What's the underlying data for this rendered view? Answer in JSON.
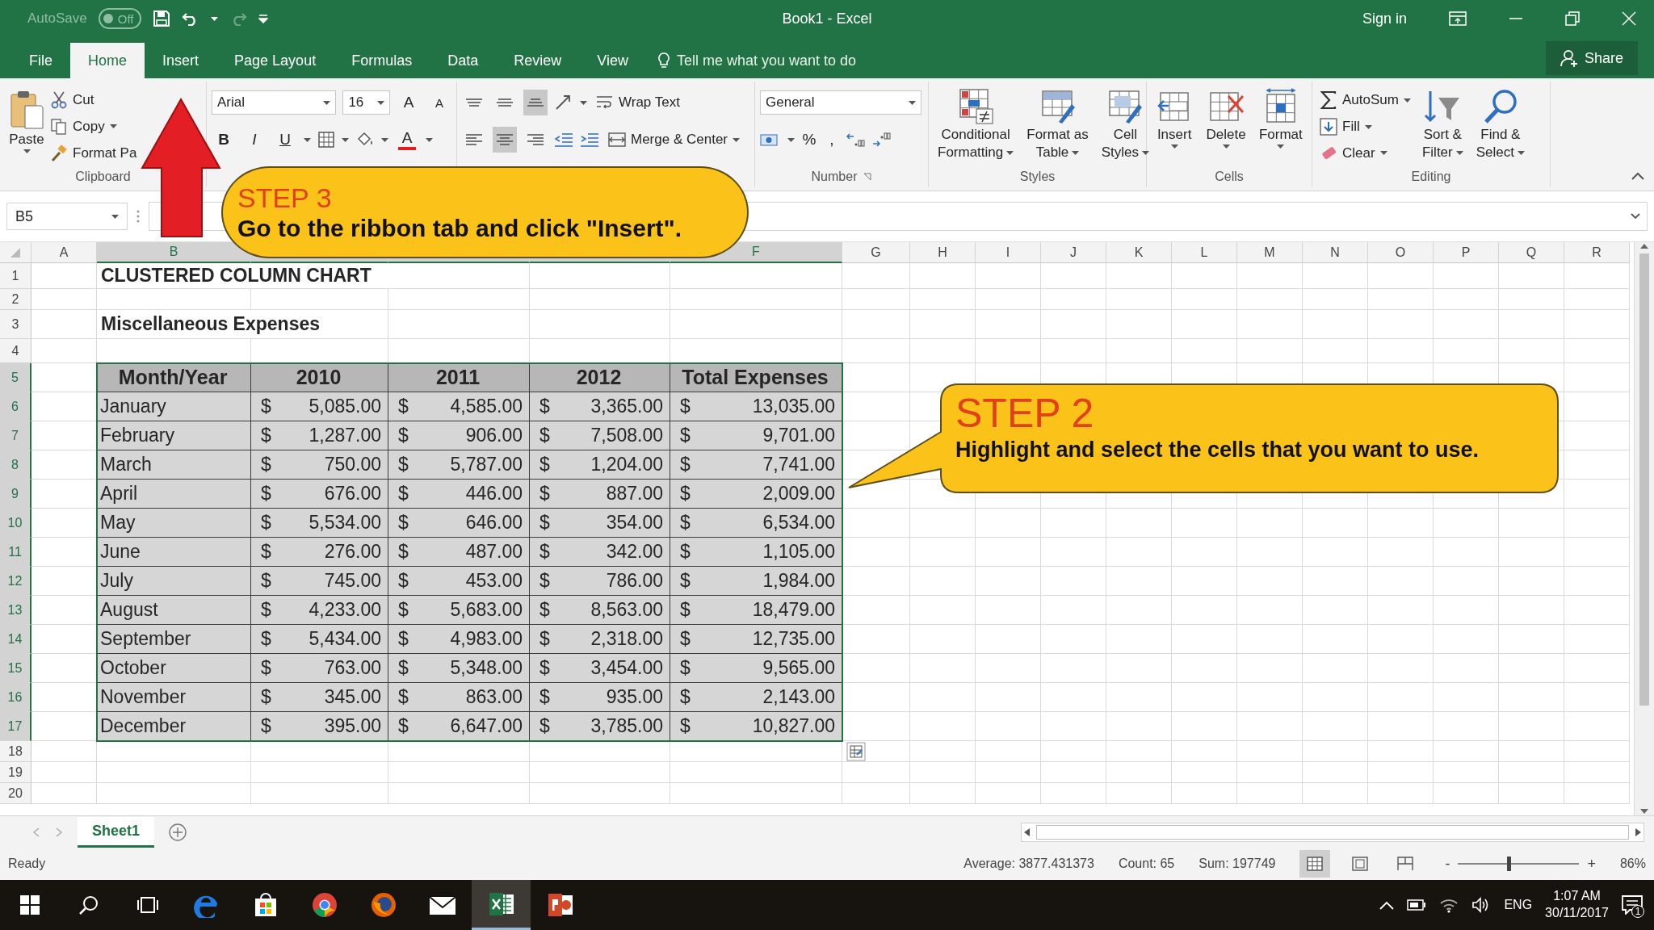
{
  "window": {
    "autosave": {
      "label": "AutoSave",
      "on": false,
      "state_text": "Off"
    },
    "title": "Book1 - Excel",
    "sign_in": "Sign in"
  },
  "tabs": [
    {
      "label": "File",
      "selected": false
    },
    {
      "label": "Home",
      "selected": true
    },
    {
      "label": "Insert",
      "selected": false
    },
    {
      "label": "Page Layout",
      "selected": false
    },
    {
      "label": "Formulas",
      "selected": false
    },
    {
      "label": "Data",
      "selected": false
    },
    {
      "label": "Review",
      "selected": false
    },
    {
      "label": "View",
      "selected": false
    }
  ],
  "tell_me": "Tell me what you want to do",
  "share": "Share",
  "ribbon": {
    "clipboard": {
      "paste": "Paste",
      "commands": [
        {
          "kind": "cut",
          "label": "Cut"
        },
        {
          "kind": "copy",
          "label": "Copy"
        },
        {
          "kind": "painter",
          "label": "Format Pa"
        }
      ],
      "label": "Clipboard"
    },
    "font": {
      "name": "Arial",
      "size": "16",
      "grow": "A",
      "shrink": "A",
      "styles": [
        "B",
        "I",
        "U"
      ],
      "color_glyph": "A"
    },
    "alignment": {
      "vertical": [
        {
          "kind": "top",
          "selected": false
        },
        {
          "kind": "middle",
          "selected": false
        },
        {
          "kind": "bottom",
          "selected": true
        }
      ],
      "horizontal": [
        {
          "kind": "left",
          "selected": false
        },
        {
          "kind": "center",
          "selected": true
        },
        {
          "kind": "right",
          "selected": false
        }
      ],
      "wrap": "Wrap Text",
      "merge": "Merge & Center"
    },
    "number": {
      "format": "General",
      "symbols": [
        "%",
        ","
      ],
      "label": "Number"
    },
    "styles": {
      "buttons": [
        {
          "kind": "conditional",
          "lines": [
            "Conditional",
            "Formatting"
          ]
        },
        {
          "kind": "table",
          "lines": [
            "Format as",
            "Table"
          ]
        },
        {
          "kind": "cell",
          "lines": [
            "Cell",
            "Styles"
          ]
        }
      ],
      "label": "Styles"
    },
    "cells": {
      "buttons": [
        {
          "kind": "insert",
          "label": "Insert"
        },
        {
          "kind": "delete",
          "label": "Delete"
        },
        {
          "kind": "format",
          "label": "Format"
        }
      ],
      "label": "Cells"
    },
    "editing": {
      "commands": [
        {
          "kind": "autosum",
          "label": "AutoSum"
        },
        {
          "kind": "fill",
          "label": "Fill"
        },
        {
          "kind": "clear",
          "label": "Clear"
        }
      ],
      "buttons": [
        {
          "kind": "sort",
          "lines": [
            "Sort &",
            "Filter"
          ]
        },
        {
          "kind": "find",
          "lines": [
            "Find &",
            "Select"
          ]
        }
      ],
      "label": "Editing"
    }
  },
  "formula_bar": {
    "name_box": "B5"
  },
  "sheet": {
    "columns": [
      {
        "label": "A",
        "selected": false
      },
      {
        "label": "B",
        "selected": true
      },
      {
        "selected": true
      },
      {
        "selected": true
      },
      {
        "selected": true
      },
      {
        "label": "F",
        "selected": true
      },
      {
        "label": "G",
        "selected": false
      },
      {
        "label": "H",
        "selected": false
      },
      {
        "label": "I",
        "selected": false
      },
      {
        "label": "J",
        "selected": false
      },
      {
        "label": "K",
        "selected": false
      },
      {
        "label": "L",
        "selected": false
      },
      {
        "label": "M",
        "selected": false
      },
      {
        "label": "N",
        "selected": false
      },
      {
        "label": "O",
        "selected": false
      },
      {
        "label": "P",
        "selected": false
      },
      {
        "label": "Q",
        "selected": false
      },
      {
        "label": "R",
        "selected": false
      }
    ],
    "rows": [
      {
        "label": "1",
        "selected": false
      },
      {
        "label": "2",
        "selected": false
      },
      {
        "label": "3",
        "selected": false
      },
      {
        "label": "4",
        "selected": false
      },
      {
        "label": "5",
        "selected": true
      },
      {
        "label": "6",
        "selected": true
      },
      {
        "label": "7",
        "selected": true
      },
      {
        "label": "8",
        "selected": true
      },
      {
        "label": "9",
        "selected": true
      },
      {
        "label": "10",
        "selected": true
      },
      {
        "label": "11",
        "selected": true
      },
      {
        "label": "12",
        "selected": true
      },
      {
        "label": "13",
        "selected": true
      },
      {
        "label": "14",
        "selected": true
      },
      {
        "label": "15",
        "selected": true
      },
      {
        "label": "16",
        "selected": true
      },
      {
        "label": "17",
        "selected": true
      },
      {
        "label": "18",
        "selected": false
      },
      {
        "label": "19",
        "selected": false
      },
      {
        "label": "20",
        "selected": false
      }
    ],
    "title": "CLUSTERED COLUMN CHART",
    "subtitle": "Miscellaneous Expenses",
    "table": {
      "header": [
        "Month/Year",
        "2010",
        "2011",
        "2012",
        "Total Expenses"
      ],
      "rows": [
        {
          "month": "January",
          "cells": [
            [
              "$",
              "5,085.00"
            ],
            [
              "$",
              "4,585.00"
            ],
            [
              "$",
              "3,365.00"
            ],
            [
              "$",
              "13,035.00"
            ]
          ]
        },
        {
          "month": "February",
          "cells": [
            [
              "$",
              "1,287.00"
            ],
            [
              "$",
              "906.00"
            ],
            [
              "$",
              "7,508.00"
            ],
            [
              "$",
              "9,701.00"
            ]
          ]
        },
        {
          "month": "March",
          "cells": [
            [
              "$",
              "750.00"
            ],
            [
              "$",
              "5,787.00"
            ],
            [
              "$",
              "1,204.00"
            ],
            [
              "$",
              "7,741.00"
            ]
          ]
        },
        {
          "month": "April",
          "cells": [
            [
              "$",
              "676.00"
            ],
            [
              "$",
              "446.00"
            ],
            [
              "$",
              "887.00"
            ],
            [
              "$",
              "2,009.00"
            ]
          ]
        },
        {
          "month": "May",
          "cells": [
            [
              "$",
              "5,534.00"
            ],
            [
              "$",
              "646.00"
            ],
            [
              "$",
              "354.00"
            ],
            [
              "$",
              "6,534.00"
            ]
          ]
        },
        {
          "month": "June",
          "cells": [
            [
              "$",
              "276.00"
            ],
            [
              "$",
              "487.00"
            ],
            [
              "$",
              "342.00"
            ],
            [
              "$",
              "1,105.00"
            ]
          ]
        },
        {
          "month": "July",
          "cells": [
            [
              "$",
              "745.00"
            ],
            [
              "$",
              "453.00"
            ],
            [
              "$",
              "786.00"
            ],
            [
              "$",
              "1,984.00"
            ]
          ]
        },
        {
          "month": "August",
          "cells": [
            [
              "$",
              "4,233.00"
            ],
            [
              "$",
              "5,683.00"
            ],
            [
              "$",
              "8,563.00"
            ],
            [
              "$",
              "18,479.00"
            ]
          ]
        },
        {
          "month": "September",
          "cells": [
            [
              "$",
              "5,434.00"
            ],
            [
              "$",
              "4,983.00"
            ],
            [
              "$",
              "2,318.00"
            ],
            [
              "$",
              "12,735.00"
            ]
          ]
        },
        {
          "month": "October",
          "cells": [
            [
              "$",
              "763.00"
            ],
            [
              "$",
              "5,348.00"
            ],
            [
              "$",
              "3,454.00"
            ],
            [
              "$",
              "9,565.00"
            ]
          ]
        },
        {
          "month": "November",
          "cells": [
            [
              "$",
              "345.00"
            ],
            [
              "$",
              "863.00"
            ],
            [
              "$",
              "935.00"
            ],
            [
              "$",
              "2,143.00"
            ]
          ]
        },
        {
          "month": "December",
          "cells": [
            [
              "$",
              "395.00"
            ],
            [
              "$",
              "6,647.00"
            ],
            [
              "$",
              "3,785.00"
            ],
            [
              "$",
              "10,827.00"
            ]
          ]
        }
      ]
    }
  },
  "sheet_tabs": [
    {
      "label": "Sheet1",
      "selected": true
    }
  ],
  "status_bar": {
    "status": "Ready",
    "average": "Average: 3877.431373",
    "count": "Count: 65",
    "sum": "Sum: 197749",
    "views": [
      {
        "kind": "normal",
        "selected": true
      },
      {
        "kind": "page_layout",
        "selected": false
      },
      {
        "kind": "page_break",
        "selected": false
      }
    ],
    "zoom": {
      "zoom_out": "-",
      "zoom_in": "+",
      "level": 0.42,
      "reading": "86%"
    }
  },
  "taskbar": {
    "apps": [
      {
        "kind": "edge",
        "selected": false
      },
      {
        "kind": "store",
        "selected": false
      },
      {
        "kind": "chrome",
        "selected": false
      },
      {
        "kind": "firefox",
        "selected": false
      },
      {
        "kind": "mail",
        "selected": false
      },
      {
        "kind": "excel",
        "selected": true
      },
      {
        "kind": "powerpoint",
        "selected": false
      }
    ],
    "language": "ENG",
    "time": "1:07 AM",
    "date": "30/11/2017",
    "notifications": "1"
  },
  "callouts": [
    {
      "kind": "ribbon_note",
      "title": "STEP 3",
      "text": "Go to the ribbon tab and click \"Insert\"."
    },
    {
      "kind": "table_note",
      "title": "STEP 2",
      "text": "Highlight and select the cells that you want to use."
    }
  ]
}
